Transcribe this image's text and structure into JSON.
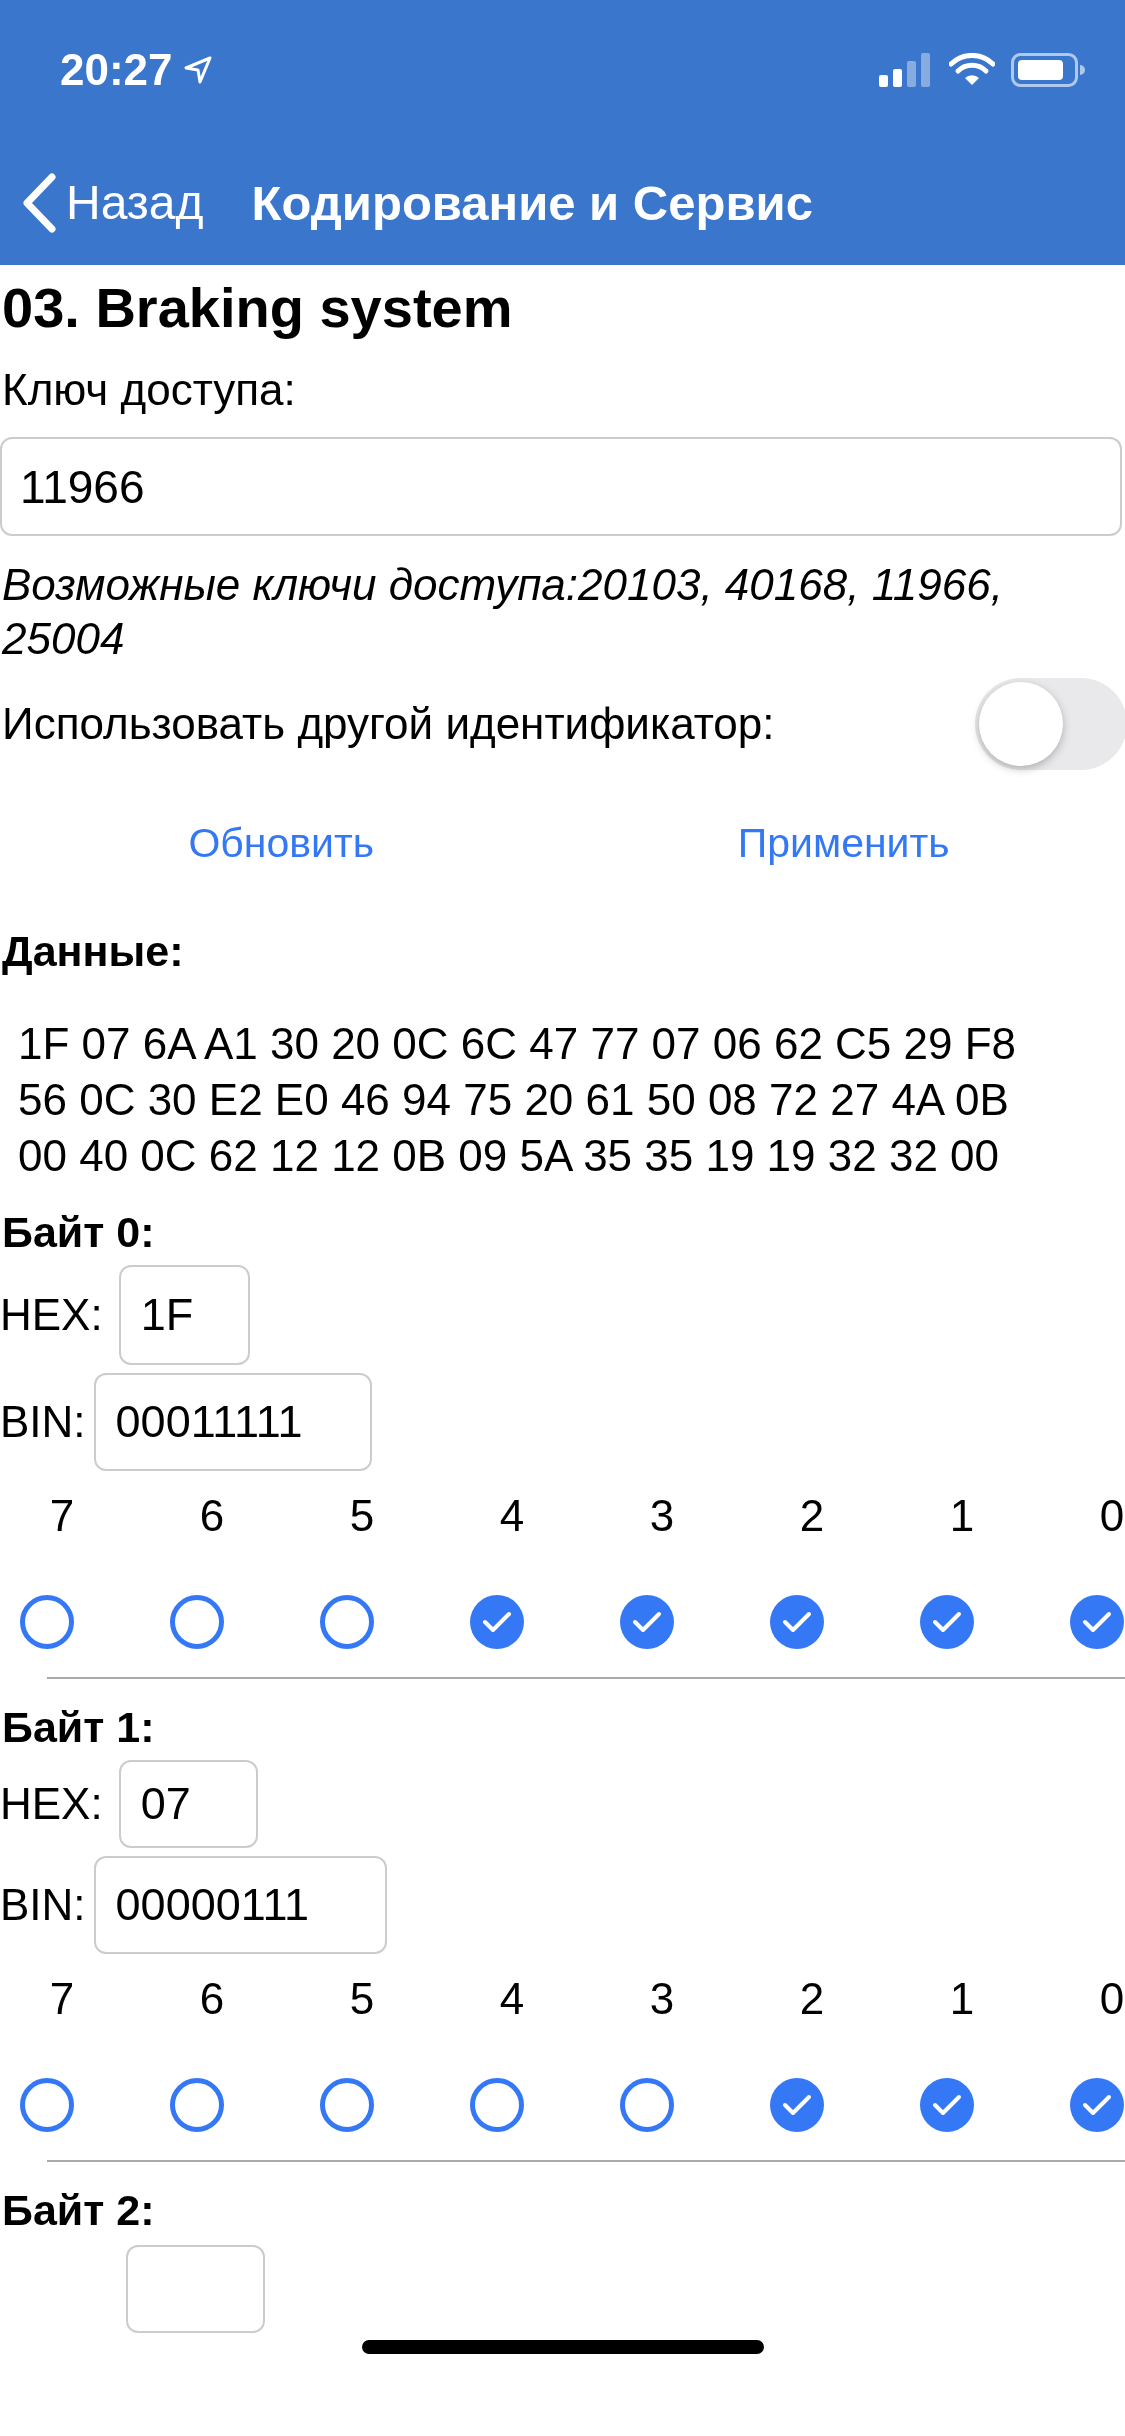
{
  "status_bar": {
    "time": "20:27"
  },
  "nav": {
    "back": "Назад",
    "title": "Кодирование и Сервис"
  },
  "heading": "03. Braking system",
  "access_key": {
    "label": "Ключ доступа:",
    "value": "11966"
  },
  "possible_keys": "Возможные ключи доступа:20103, 40168, 11966, 25004",
  "other_id": {
    "label": "Использовать другой идентификатор:",
    "on": false
  },
  "actions": [
    "Обновить",
    "Применить"
  ],
  "data_label": "Данные:",
  "data_hex": "1F 07 6A A1 30 20 0C 6C 47 77 07 06 62 C5 29 F8 56 0C 30 E2 E0 46 94 75 20 61 50 08 72 27 4A 0B 00 40 0C 62 12 12 0B 09 5A 35 35 19 19 32 32 00",
  "bytes": [
    {
      "title": "Байт 0:",
      "hex_label": "HEX:",
      "hex": "1F",
      "bin_label": "BIN:",
      "bin": "00011111",
      "bits": [
        {
          "label": "7",
          "checked": false
        },
        {
          "label": "6",
          "checked": false
        },
        {
          "label": "5",
          "checked": false
        },
        {
          "label": "4",
          "checked": true
        },
        {
          "label": "3",
          "checked": true
        },
        {
          "label": "2",
          "checked": true
        },
        {
          "label": "1",
          "checked": true
        },
        {
          "label": "0",
          "checked": true
        }
      ]
    },
    {
      "title": "Байт 1:",
      "hex_label": "HEX:",
      "hex": "07",
      "bin_label": "BIN:",
      "bin": "00000111",
      "bits": [
        {
          "label": "7",
          "checked": false
        },
        {
          "label": "6",
          "checked": false
        },
        {
          "label": "5",
          "checked": false
        },
        {
          "label": "4",
          "checked": false
        },
        {
          "label": "3",
          "checked": false
        },
        {
          "label": "2",
          "checked": true
        },
        {
          "label": "1",
          "checked": true
        },
        {
          "label": "0",
          "checked": true
        }
      ]
    },
    {
      "title": "Байт 2:"
    }
  ]
}
